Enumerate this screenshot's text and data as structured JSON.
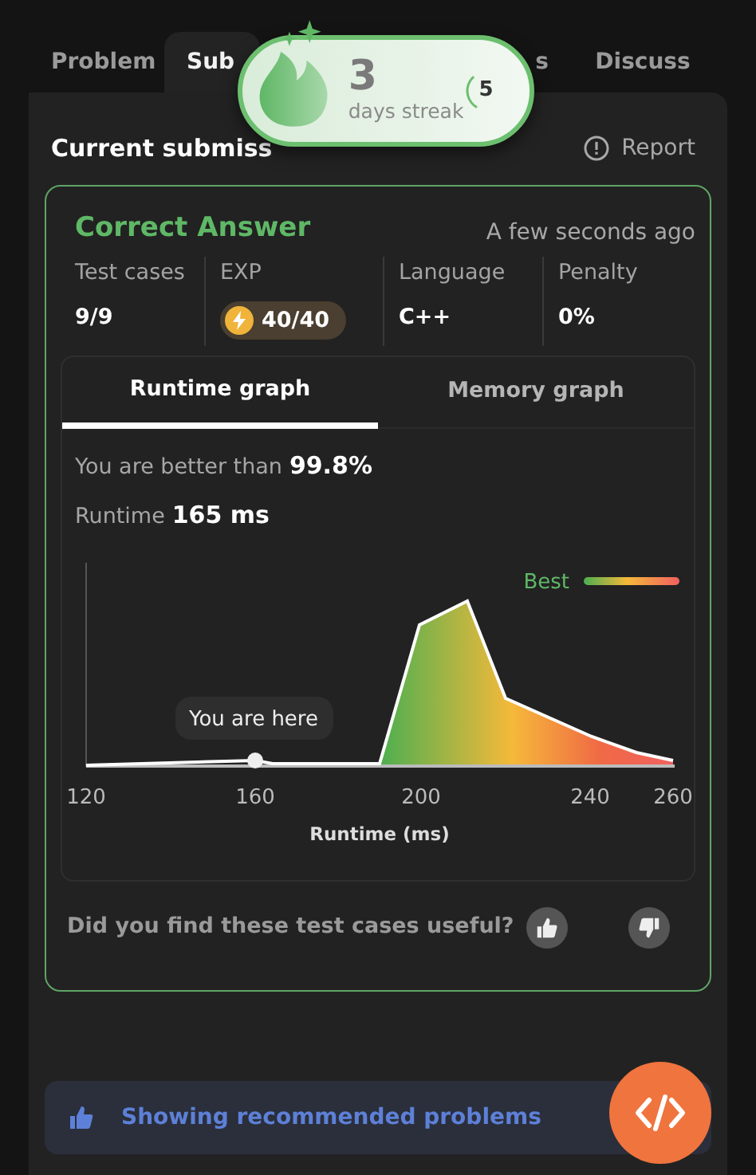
{
  "tabs": [
    {
      "label": "Problem",
      "selected": false
    },
    {
      "label": "Sub",
      "selected": true
    },
    {
      "label": "s",
      "selected": false
    },
    {
      "label": "Discuss",
      "selected": false
    }
  ],
  "streak": {
    "count": "3",
    "caption": "days streak",
    "goal": "5",
    "level": 0.3
  },
  "header": {
    "title": "Current submiss",
    "report": "Report"
  },
  "result": {
    "status": "Correct Answer",
    "time": "A few seconds ago",
    "stats": [
      {
        "label": "Test cases",
        "value": "9/9",
        "kind": "text"
      },
      {
        "label": "EXP",
        "value": "40/40",
        "kind": "exp"
      },
      {
        "label": "Language",
        "value": "C++",
        "kind": "text"
      },
      {
        "label": "Penalty",
        "value": "0%",
        "kind": "text"
      }
    ]
  },
  "graph_tabs": [
    {
      "label": "Runtime graph",
      "selected": true
    },
    {
      "label": "Memory graph",
      "selected": false
    }
  ],
  "better": {
    "label": "You are better than",
    "value": "99.8%"
  },
  "runtime": {
    "label": "Runtime",
    "value": "165 ms"
  },
  "chart": {
    "legend": "Best",
    "marker": "You are here",
    "ticks": [
      "120",
      "160",
      "200",
      "240",
      "260"
    ],
    "xlabel": "Runtime (ms)"
  },
  "feedback": {
    "question": "Did you find these test cases useful?"
  },
  "banner": {
    "text": "Showing recommended problems"
  }
}
